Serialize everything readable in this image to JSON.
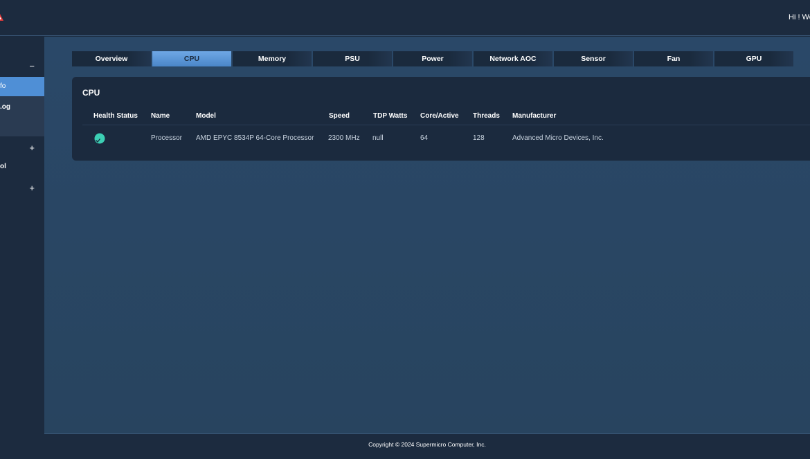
{
  "header": {
    "greeting": "Hi ! We",
    "logo_icon": "supermicro-logo-icon"
  },
  "sidebar": {
    "items": [
      {
        "label": "",
        "toggle": "−"
      },
      {
        "label": "fo",
        "toggle": ""
      },
      {
        "label": ".og",
        "toggle": ""
      },
      {
        "label": "",
        "toggle": "+"
      },
      {
        "label": "ol",
        "toggle": ""
      },
      {
        "label": "",
        "toggle": "+"
      }
    ]
  },
  "tabs": [
    "Overview",
    "CPU",
    "Memory",
    "PSU",
    "Power",
    "Network AOC",
    "Sensor",
    "Fan",
    "GPU"
  ],
  "active_tab": "CPU",
  "panel": {
    "title": "CPU",
    "columns": [
      "Health Status",
      "Name",
      "Model",
      "Speed",
      "TDP Watts",
      "Core/Active",
      "Threads",
      "Manufacturer"
    ],
    "rows": [
      {
        "health": "ok",
        "name": "Processor",
        "model": "AMD EPYC 8534P 64-Core Processor",
        "speed": "2300 MHz",
        "tdp": "null",
        "cores": "64",
        "threads": "128",
        "manufacturer": "Advanced Micro Devices, Inc."
      }
    ]
  },
  "footer": {
    "copyright": "Copyright © 2024 Supermicro Computer, Inc."
  },
  "colors": {
    "accent": "#4f8fd6",
    "health_ok": "#3ccfb4"
  }
}
